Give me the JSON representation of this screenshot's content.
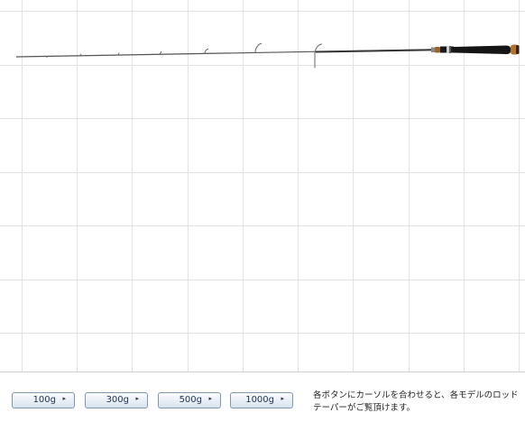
{
  "buttons": [
    {
      "label": "100g",
      "arrow": "▸",
      "icon": "play-arrow-icon"
    },
    {
      "label": "300g",
      "arrow": "▸",
      "icon": "play-arrow-icon"
    },
    {
      "label": "500g",
      "arrow": "▸",
      "icon": "play-arrow-icon"
    },
    {
      "label": "1000g",
      "arrow": "▸",
      "icon": "play-arrow-icon"
    }
  ],
  "hint_text": "各ボタンにカーソルを合わせると、各モデルのロッドテーパーがご覧頂けます。",
  "colors": {
    "grid_line": "#e2e2e2",
    "rod_blank": "#444444",
    "rod_handle": "#111111",
    "rod_cork": "#a0642a",
    "button_border": "#7f98b6"
  }
}
